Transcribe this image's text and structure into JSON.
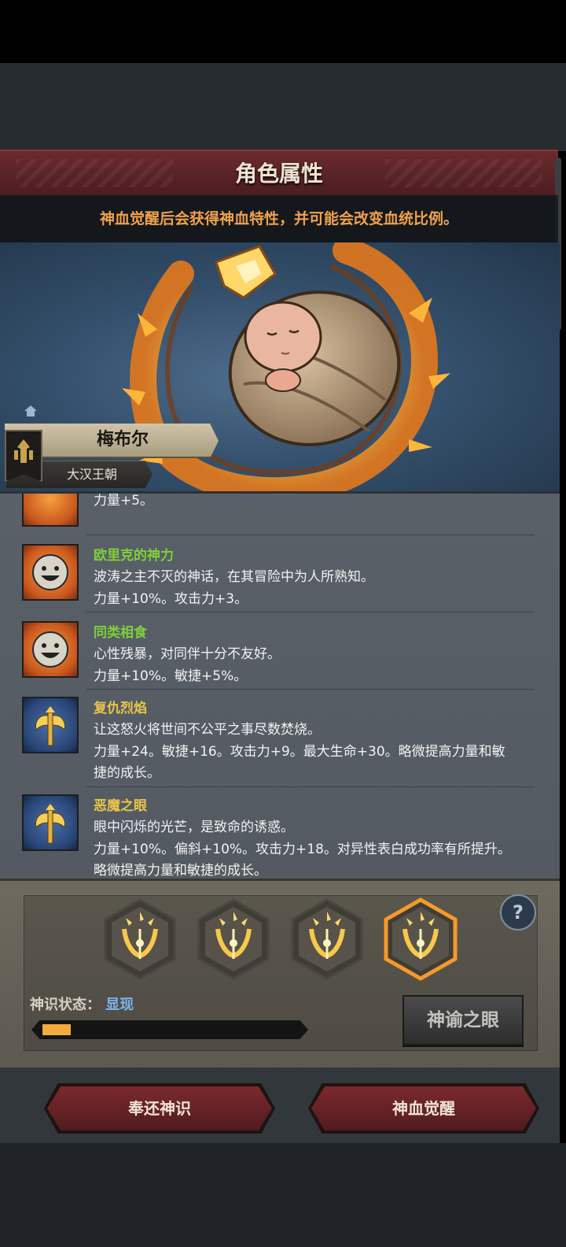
{
  "header": {
    "title": "角色属性"
  },
  "hint": "神血觉醒后会获得神血特性，并可能会改变血统比例。",
  "character": {
    "name": "梅布尔",
    "dynasty": "大汉王朝"
  },
  "traits": [
    {
      "name": "",
      "desc": "",
      "effect": "力量+5。",
      "icon": "smile-face-icon"
    },
    {
      "name": "欧里克的神力",
      "desc": "波涛之主不灭的神话，在其冒险中为人所熟知。",
      "effect": "力量+10%。攻击力+3。",
      "icon": "smile-face-icon",
      "name_color": "#7fcf3a"
    },
    {
      "name": "同类相食",
      "desc": "心性残暴，对同伴十分不友好。",
      "effect": "力量+10%。敏捷+5%。",
      "icon": "smile-face-icon",
      "name_color": "#7fcf3a"
    },
    {
      "name": "复仇烈焰",
      "desc": "让这怒火将世间不公平之事尽数焚烧。",
      "effect": "力量+24。敏捷+16。攻击力+9。最大生命+30。略微提高力量和敏",
      "effect2": "捷的成长。",
      "icon": "golden-axe-icon",
      "name_color": "#e6c54a"
    },
    {
      "name": "恶魔之眼",
      "desc": "眼中闪烁的光芒，是致命的诱惑。",
      "effect": "力量+10%。偏斜+10%。攻击力+18。对异性表白成功率有所提升。",
      "effect2": "略微提高力量和敏捷的成长。",
      "icon": "golden-axe-icon",
      "name_color": "#e6c54a"
    }
  ],
  "divine": {
    "status_label": "神识状态：",
    "status_value": "显现",
    "progress": 0.1,
    "oracle_button": "神谕之眼",
    "slots": [
      "divine-sigil-icon",
      "divine-sigil-icon",
      "divine-sigil-icon",
      "divine-sigil-icon"
    ],
    "selected_slot": 3
  },
  "buttons": {
    "return": "奉还神识",
    "awaken": "神血觉醒"
  },
  "colors": {
    "accent": "#f0a14a",
    "banner": "#6b2a2d",
    "highlight": "#f39a2a"
  }
}
